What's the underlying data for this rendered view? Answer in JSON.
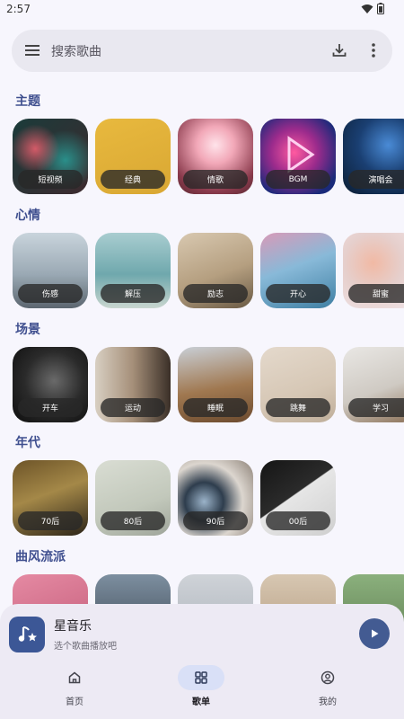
{
  "status": {
    "time": "2:57"
  },
  "search": {
    "placeholder": "搜索歌曲"
  },
  "sections": [
    {
      "title": "主题",
      "items": [
        "短视频",
        "经典",
        "情歌",
        "BGM",
        "演唱会"
      ]
    },
    {
      "title": "心情",
      "items": [
        "伤感",
        "解压",
        "励志",
        "开心",
        "甜蜜"
      ]
    },
    {
      "title": "场景",
      "items": [
        "开车",
        "运动",
        "睡眠",
        "跳舞",
        "学习"
      ]
    },
    {
      "title": "年代",
      "items": [
        "70后",
        "80后",
        "90后",
        "00后"
      ]
    },
    {
      "title": "曲风流派",
      "items": []
    }
  ],
  "player": {
    "title": "星音乐",
    "subtitle": "选个歌曲播放吧"
  },
  "nav": {
    "home": "首页",
    "playlist": "歌单",
    "mine": "我的"
  },
  "colors": {
    "accent": "#435b92",
    "section_title": "#3f4f8f",
    "active_nav_bg": "#d9e0f7"
  }
}
